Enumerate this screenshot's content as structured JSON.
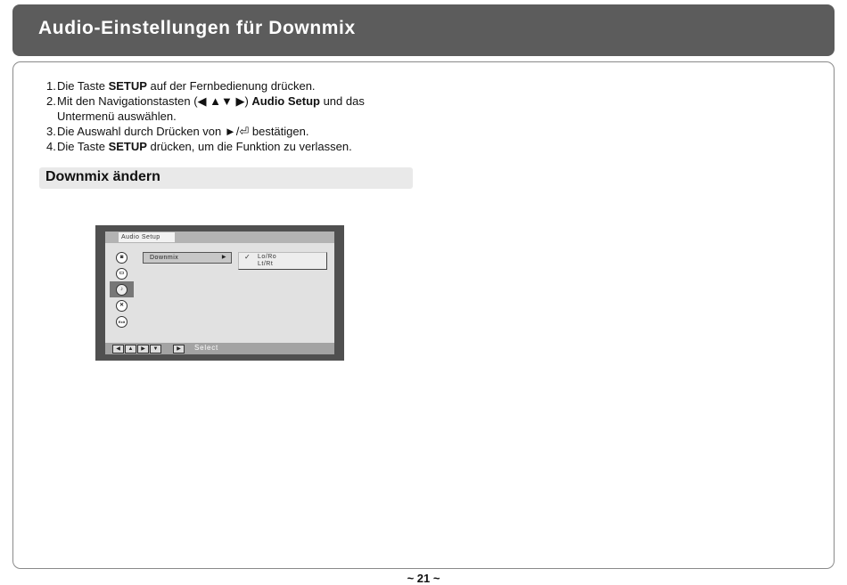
{
  "header": {
    "title": "Audio-Einstellungen für Downmix"
  },
  "steps": [
    {
      "num": "1.",
      "parts": [
        "Die Taste ",
        "SETUP",
        " auf der Fernbedienung drücken."
      ]
    },
    {
      "num": "2.",
      "parts": [
        "Mit den Navigationstasten (◀ ▲▼ ▶) ",
        "Audio Setup",
        " und das Untermenü auswählen."
      ]
    },
    {
      "num": "3.",
      "text": "Die Auswahl durch Drücken von ►/⏎ bestätigen."
    },
    {
      "num": "4.",
      "parts": [
        "Die Taste ",
        "SETUP",
        " drücken, um die Funktion zu verlassen."
      ]
    }
  ],
  "section": {
    "title": "Downmix ändern"
  },
  "osd": {
    "tab_label": "Audio Setup",
    "icons": [
      "speaker-icon",
      "monitor-icon",
      "audio-icon",
      "tools-icon",
      "exit-icon"
    ],
    "icon_glyphs": [
      "◙",
      "▭",
      "♪",
      "✕",
      "Exit"
    ],
    "menu_item": "Downmix",
    "menu_arrow": "▶",
    "check": "✓",
    "options": [
      "Lo/Ro",
      "Lt/Rt"
    ],
    "footer_keys": [
      "◀",
      "▲",
      "▶",
      "▼",
      "▶"
    ],
    "footer_label": "Select"
  },
  "page": {
    "number": "~ 21 ~"
  }
}
